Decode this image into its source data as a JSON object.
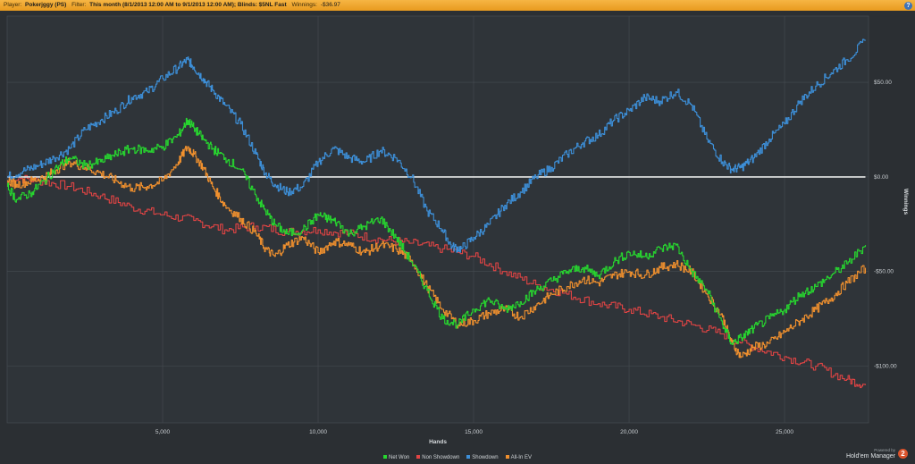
{
  "header": {
    "player_label": "Player:",
    "player_value": "Pokerjggy (PS)",
    "filter_label": "Filter:",
    "filter_value": "This month (8/1/2013 12:00 AM to 9/1/2013 12:00 AM); Blinds: $5NL Fast",
    "winnings_label": "Winnings:",
    "winnings_value": "-$36.97",
    "help_label": "?"
  },
  "brand": {
    "powered_by": "Powered by",
    "name": "Hold'em Manager",
    "logo_text": "2"
  },
  "chart_data": {
    "type": "line",
    "xlabel": "Hands",
    "ylabel": "Winnings",
    "xlim": [
      0,
      27700
    ],
    "ylim": [
      -130,
      85
    ],
    "x_ticks": [
      5000,
      10000,
      15000,
      20000,
      25000
    ],
    "x_tick_labels": [
      "5,000",
      "10,000",
      "15,000",
      "20,000",
      "25,000"
    ],
    "y_ticks": [
      50,
      0,
      -50,
      -100
    ],
    "y_tick_labels": [
      "$50.00",
      "$0.00",
      "-$50.00",
      "-$100.00"
    ],
    "grid": true,
    "legend_position": "bottom-center",
    "series": [
      {
        "name": "Net Won",
        "color": "#27d62f",
        "x": [
          0,
          300,
          800,
          1200,
          1600,
          2000,
          2500,
          3000,
          3500,
          4000,
          4500,
          5000,
          5500,
          5800,
          6000,
          6300,
          6600,
          7000,
          7500,
          8000,
          8300,
          8600,
          9000,
          9500,
          10000,
          10300,
          10600,
          11000,
          11500,
          12000,
          12500,
          13000,
          13500,
          14000,
          14500,
          15000,
          15500,
          16000,
          16500,
          17000,
          17500,
          18000,
          18500,
          19000,
          19500,
          20000,
          20500,
          21000,
          21500,
          22000,
          22500,
          23000,
          23300,
          23600,
          24000,
          24500,
          25000,
          25500,
          26000,
          26500,
          27000,
          27600
        ],
        "y": [
          -5,
          -12,
          -8,
          -2,
          5,
          10,
          6,
          8,
          12,
          15,
          14,
          16,
          22,
          30,
          26,
          20,
          15,
          10,
          4,
          -10,
          -18,
          -25,
          -30,
          -28,
          -20,
          -22,
          -24,
          -30,
          -26,
          -22,
          -32,
          -45,
          -60,
          -75,
          -78,
          -70,
          -65,
          -70,
          -66,
          -60,
          -55,
          -50,
          -48,
          -52,
          -45,
          -40,
          -42,
          -38,
          -36,
          -50,
          -60,
          -78,
          -88,
          -85,
          -80,
          -75,
          -70,
          -62,
          -58,
          -52,
          -46,
          -36
        ]
      },
      {
        "name": "Non Showdown",
        "color": "#e24444",
        "x": [
          0,
          1000,
          2000,
          3000,
          4000,
          5000,
          6000,
          7000,
          8000,
          9000,
          10000,
          11000,
          12000,
          13000,
          14000,
          15000,
          16000,
          17000,
          18000,
          19000,
          20000,
          21000,
          22000,
          23000,
          24000,
          25000,
          26000,
          27000,
          27600
        ],
        "y": [
          0,
          -2,
          -5,
          -10,
          -16,
          -20,
          -23,
          -28,
          -26,
          -29,
          -28,
          -30,
          -33,
          -35,
          -38,
          -42,
          -50,
          -57,
          -62,
          -67,
          -70,
          -74,
          -78,
          -83,
          -90,
          -95,
          -100,
          -107,
          -110
        ]
      },
      {
        "name": "Showdown",
        "color": "#3d8fd8",
        "x": [
          0,
          500,
          1000,
          1500,
          2000,
          2500,
          3000,
          3500,
          4000,
          4500,
          5000,
          5500,
          5800,
          6000,
          6300,
          6600,
          7000,
          7500,
          8000,
          8300,
          8600,
          9000,
          9500,
          10000,
          10500,
          11000,
          11500,
          12000,
          12500,
          13000,
          13500,
          14000,
          14300,
          14600,
          15000,
          15500,
          16000,
          16500,
          17000,
          17500,
          18000,
          18500,
          19000,
          19500,
          20000,
          20500,
          21000,
          21500,
          22000,
          22500,
          23000,
          23300,
          23600,
          24000,
          24500,
          25000,
          25500,
          26000,
          26500,
          27000,
          27600
        ],
        "y": [
          0,
          3,
          6,
          10,
          15,
          25,
          30,
          35,
          42,
          45,
          52,
          58,
          62,
          58,
          52,
          46,
          38,
          28,
          12,
          2,
          -4,
          -8,
          -5,
          8,
          15,
          10,
          8,
          14,
          10,
          0,
          -18,
          -28,
          -37,
          -38,
          -32,
          -25,
          -15,
          -8,
          0,
          5,
          12,
          18,
          22,
          30,
          35,
          42,
          40,
          45,
          38,
          20,
          8,
          4,
          5,
          10,
          20,
          28,
          40,
          48,
          55,
          62,
          72
        ]
      },
      {
        "name": "All-In EV",
        "color": "#f0902e",
        "x": [
          0,
          300,
          800,
          1200,
          1600,
          2000,
          2500,
          3000,
          3500,
          4000,
          4500,
          5000,
          5500,
          5800,
          6000,
          6300,
          6600,
          7000,
          7500,
          8000,
          8300,
          8600,
          9000,
          9500,
          10000,
          10500,
          11000,
          11500,
          12000,
          12500,
          13000,
          13500,
          14000,
          14500,
          15000,
          15500,
          16000,
          16500,
          17000,
          17500,
          18000,
          18500,
          19000,
          19500,
          20000,
          20500,
          21000,
          21500,
          22000,
          22500,
          23000,
          23300,
          23600,
          24000,
          24500,
          25000,
          25500,
          26000,
          26500,
          27000,
          27600
        ],
        "y": [
          -2,
          -4,
          -2,
          0,
          4,
          8,
          5,
          2,
          -2,
          -6,
          -5,
          -2,
          8,
          16,
          12,
          5,
          -5,
          -15,
          -22,
          -30,
          -38,
          -42,
          -36,
          -32,
          -40,
          -34,
          -36,
          -40,
          -36,
          -38,
          -44,
          -58,
          -70,
          -78,
          -76,
          -72,
          -70,
          -74,
          -68,
          -62,
          -58,
          -54,
          -56,
          -52,
          -50,
          -52,
          -48,
          -46,
          -50,
          -62,
          -74,
          -88,
          -95,
          -90,
          -88,
          -82,
          -76,
          -70,
          -64,
          -56,
          -48
        ]
      },
      {
        "name": "",
        "color": "#e8e8e8",
        "x": [
          0,
          27600
        ],
        "y": [
          0,
          0
        ]
      }
    ]
  }
}
